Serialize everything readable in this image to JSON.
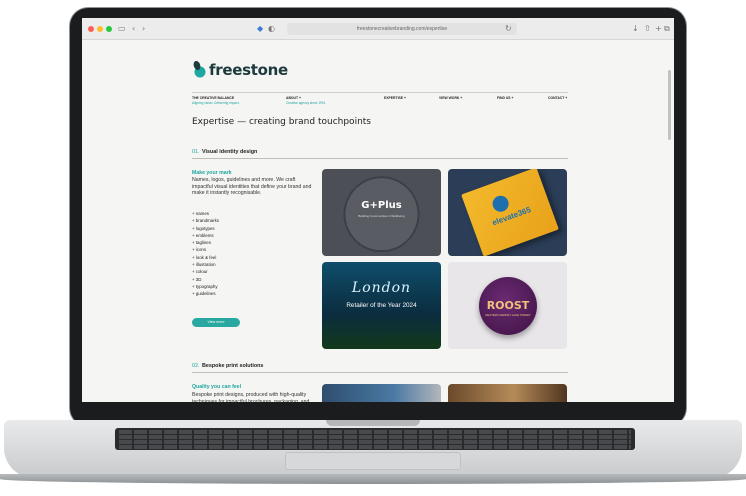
{
  "browser": {
    "url": "freestonecreativebranding.com/expertise",
    "colors": {
      "close": "#fe5f57",
      "minimize": "#febc2e",
      "maximize": "#28c840"
    }
  },
  "brand": {
    "name": "freestone",
    "accent": "#1ea6a0"
  },
  "nav": {
    "items": [
      {
        "label": "THE CREATIVE BALANCE",
        "sub": "Aligning vision. Delivering impact."
      },
      {
        "label": "ABOUT +",
        "sub": "Creative agency since 1991"
      },
      {
        "label": "EXPERTISE +",
        "sub": ""
      },
      {
        "label": "VIEW WORK +",
        "sub": ""
      },
      {
        "label": "FIND US +",
        "sub": ""
      },
      {
        "label": "CONTACT +",
        "sub": ""
      }
    ]
  },
  "page_title": "Expertise — creating brand touchpoints",
  "sections": [
    {
      "number": "01.",
      "title": "Visual identity design",
      "intro_title": "Make your mark",
      "intro_body": "Names, logos, guidelines and more. We craft impactful visual identities that define your brand and make it instantly recognisable.",
      "bullets": [
        "names",
        "brandmarks",
        "logotypes",
        "emblems",
        "taglines",
        "icons",
        "look & feel",
        "illustration",
        "colour",
        "3D",
        "typography",
        "guidelines"
      ],
      "button_label": "View more",
      "tiles": {
        "t1_title": "G+Plus",
        "t1_sub": "Building Communities in Wellbeing",
        "t2_title": "elevate365",
        "t3_script": "London",
        "t3_caption": "Retailer of the Year 2024",
        "t4_title": "ROOST",
        "t4_sub": "DEXTERS MARKET LAKE STREET"
      }
    },
    {
      "number": "02.",
      "title": "Bespoke print solutions",
      "intro_title": "Quality you can feel",
      "intro_body": "Bespoke print designs, produced with high-quality techniques for impactful brochures, packaging, and more. Make a tangible impression."
    }
  ]
}
